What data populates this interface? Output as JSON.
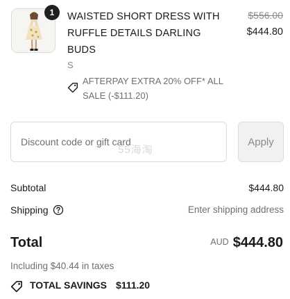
{
  "line_item": {
    "quantity": "1",
    "name": "WAISTED SHORT DRESS WITH RUFFLE DETAILS DARLING BUDS",
    "variant": "S",
    "discount_text": "AFTERPAY EXTRA 20% OFF* ALL SALE (-$111.20)",
    "original_price": "$556.00",
    "current_price": "$444.80"
  },
  "discount_form": {
    "placeholder": "Discount code or gift card",
    "apply_label": "Apply"
  },
  "watermark": "55海淘",
  "summary": {
    "subtotal_label": "Subtotal",
    "subtotal_value": "$444.80",
    "shipping_label": "Shipping",
    "shipping_value": "Enter shipping address",
    "total_label": "Total",
    "total_currency": "AUD",
    "total_value": "$444.80",
    "taxes_text": "Including $40.44 in taxes",
    "savings_label": "TOTAL SAVINGS",
    "savings_value": "$111.20"
  },
  "icons": {
    "tag": "tag-icon",
    "help": "question-circle-icon"
  }
}
